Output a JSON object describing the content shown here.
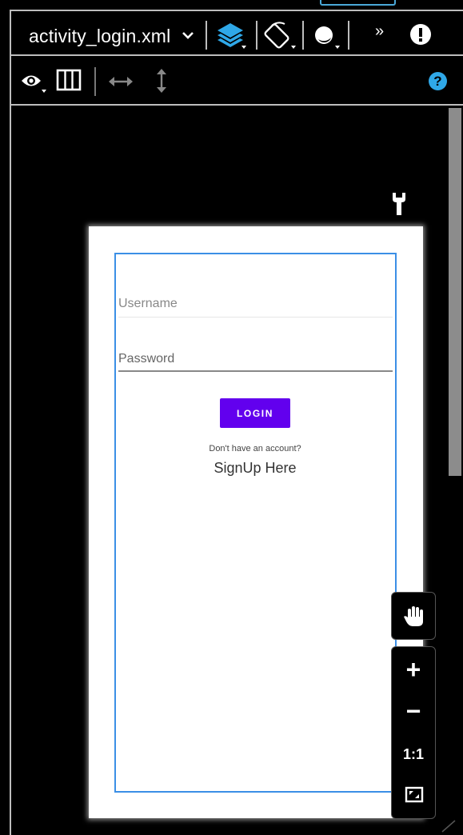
{
  "toolbar": {
    "file_name": "activity_login.xml",
    "overflow_glyph": "»",
    "help_glyph": "?"
  },
  "preview": {
    "username_hint": "Username",
    "password_hint": "Password",
    "login_label": "LOGIN",
    "no_account_text": "Don't have an account?",
    "signup_text": "SignUp Here"
  },
  "zoom": {
    "zoom_in": "+",
    "zoom_out": "−",
    "actual_size": "1:1"
  },
  "colors": {
    "button": "#6200ee",
    "selection": "#3b8fe6",
    "accent_blue": "#4aa8d8"
  }
}
